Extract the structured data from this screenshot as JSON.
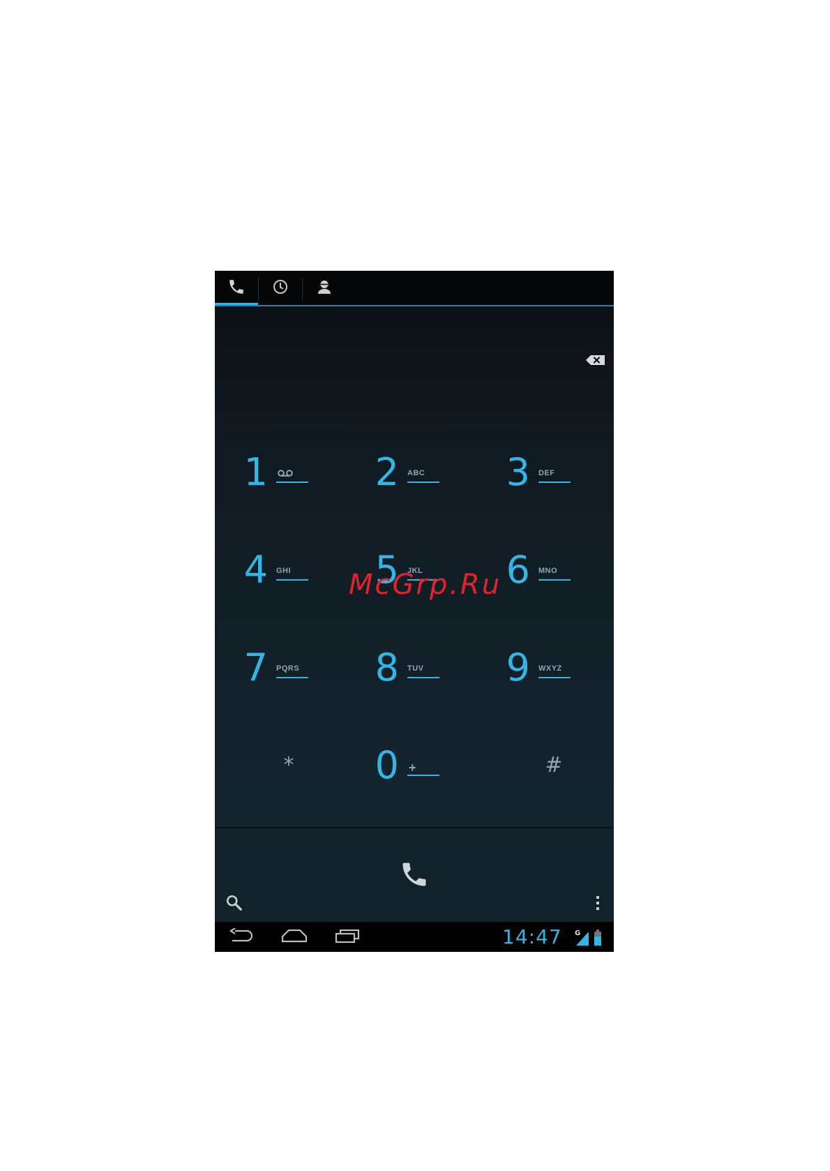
{
  "tabs": [
    {
      "name": "dialer",
      "icon": "phone-icon",
      "active": true
    },
    {
      "name": "call-log",
      "icon": "clock-icon",
      "active": false
    },
    {
      "name": "contacts",
      "icon": "contact-icon",
      "active": false
    }
  ],
  "display": {
    "number": ""
  },
  "dialpad": {
    "keys": [
      {
        "digit": "1",
        "letters": "",
        "sub_icon": "voicemail-icon"
      },
      {
        "digit": "2",
        "letters": "ABC"
      },
      {
        "digit": "3",
        "letters": "DEF"
      },
      {
        "digit": "4",
        "letters": "GHI"
      },
      {
        "digit": "5",
        "letters": "JKL"
      },
      {
        "digit": "6",
        "letters": "MNO"
      },
      {
        "digit": "7",
        "letters": "PQRS"
      },
      {
        "digit": "8",
        "letters": "TUV"
      },
      {
        "digit": "9",
        "letters": "WXYZ"
      },
      {
        "symbol": "*"
      },
      {
        "digit": "0",
        "letters": "+"
      },
      {
        "symbol": "#"
      }
    ]
  },
  "statusbar": {
    "time": "14:47",
    "network": "G"
  },
  "watermark": "McGrp.Ru",
  "colors": {
    "accent": "#33b5e5",
    "background": "#0a0d10",
    "dialpad_bg": "#12212a",
    "letters": "#8fa7b2",
    "watermark": "#e0242e"
  }
}
